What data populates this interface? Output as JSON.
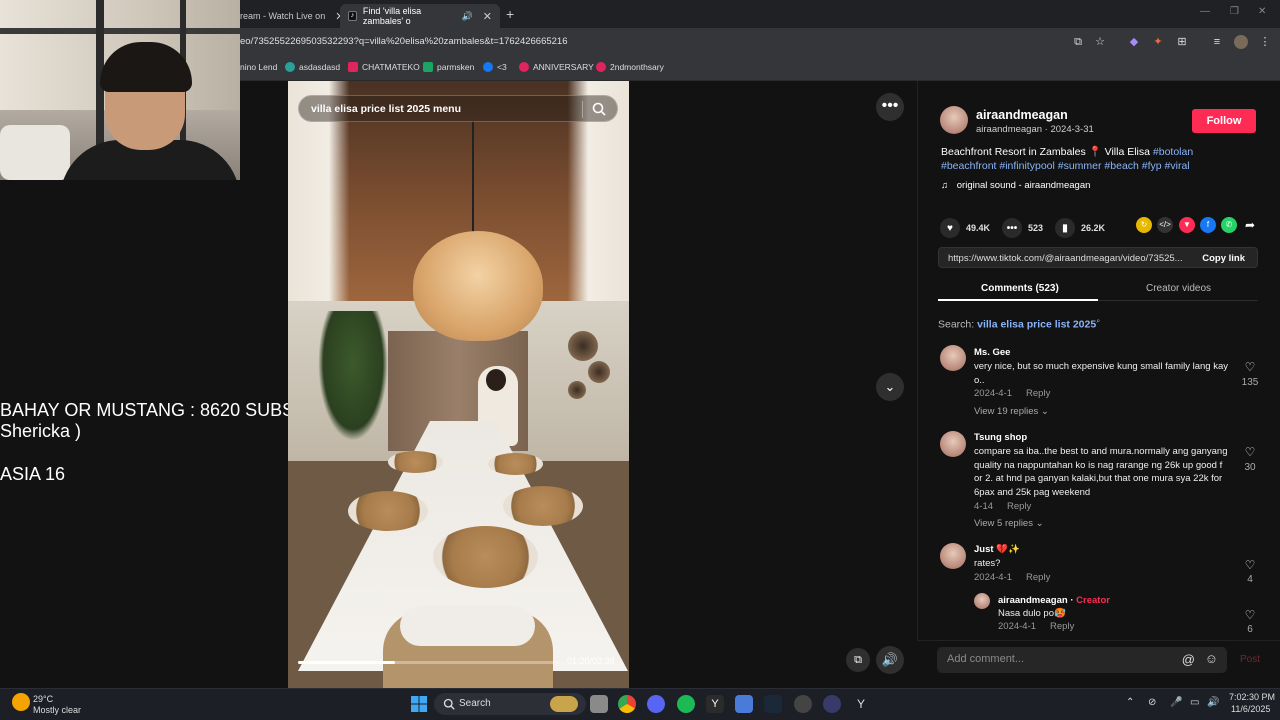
{
  "browser": {
    "tabs": [
      {
        "label": "ream - Watch Live on",
        "active": false
      },
      {
        "label": "Find 'villa elisa zambales' o",
        "active": true
      }
    ],
    "url": "eo/7352552269503532293?q=villa%20elisa%20zambales&t=1762426665216",
    "bookmarks": [
      "nino Lend",
      "asdasdasd",
      "CHATMATEKO",
      "parmsken",
      "<3",
      "ANNIVERSARY",
      "2ndmonthsary"
    ]
  },
  "stream_overlay": {
    "line1": "BAHAY OR MUSTANG : 8620 SUBS",
    "line2": "Shericka )",
    "line3": "ASIA 16"
  },
  "video": {
    "search_text": "villa elisa price list 2025 menu",
    "time": "01:20/03:38",
    "progress": 0.37
  },
  "author": {
    "username": "airaandmeagan",
    "sub": "airaandmeagan · 2024-3-31",
    "follow_label": "Follow",
    "description_plain": "Beachfront Resort in Zambales 📍 Villa Elisa ",
    "hashtags_line1": "#botolan",
    "hashtags_line2": "#beachfront #infinitypool #summer #beach #fyp #viral",
    "music": "original sound - airaandmeagan"
  },
  "stats": {
    "likes": "49.4K",
    "comments": "523",
    "saves": "26.2K"
  },
  "link": {
    "url": "https://www.tiktok.com/@airaandmeagan/video/73525...",
    "copy_label": "Copy link"
  },
  "tabs": {
    "comments": "Comments (523)",
    "creator": "Creator videos"
  },
  "search_prefix": "Search: ",
  "search_term": "villa elisa price list 2025",
  "comments": [
    {
      "name": "Ms. Gee",
      "text": "very nice, but so much expensive kung small family lang kay o..",
      "date": "2024-4-1",
      "reply": "Reply",
      "replies": "View 19 replies",
      "likes": "135"
    },
    {
      "name": "Tsung shop",
      "text": "compare sa iba..the best to and mura.normally ang ganyang quality na nappuntahan ko is nag rarange ng 26k up good f or 2. at hnd pa ganyan kalaki,but that one mura sya 22k for 6pax and 25k pag weekend",
      "date": "4-14",
      "reply": "Reply",
      "replies": "View 5 replies",
      "likes": "30"
    },
    {
      "name": "Just 💔✨",
      "text": "rates?",
      "date": "2024-4-1",
      "reply": "Reply",
      "likes": "4"
    }
  ],
  "reply": {
    "name": "airaandmeagan",
    "badge": "Creator",
    "text": "Nasa dulo po🥵",
    "date": "2024-4-1",
    "reply": "Reply",
    "likes": "6"
  },
  "composer": {
    "placeholder": "Add comment...",
    "post": "Post"
  },
  "taskbar": {
    "weather_temp": "29°C",
    "weather_desc": "Mostly clear",
    "search": "Search",
    "time": "7:02:30 PM",
    "date": "11/6/2025"
  },
  "colors": {
    "accent": "#fe2c55",
    "hashtag": "#8ab4f8"
  }
}
